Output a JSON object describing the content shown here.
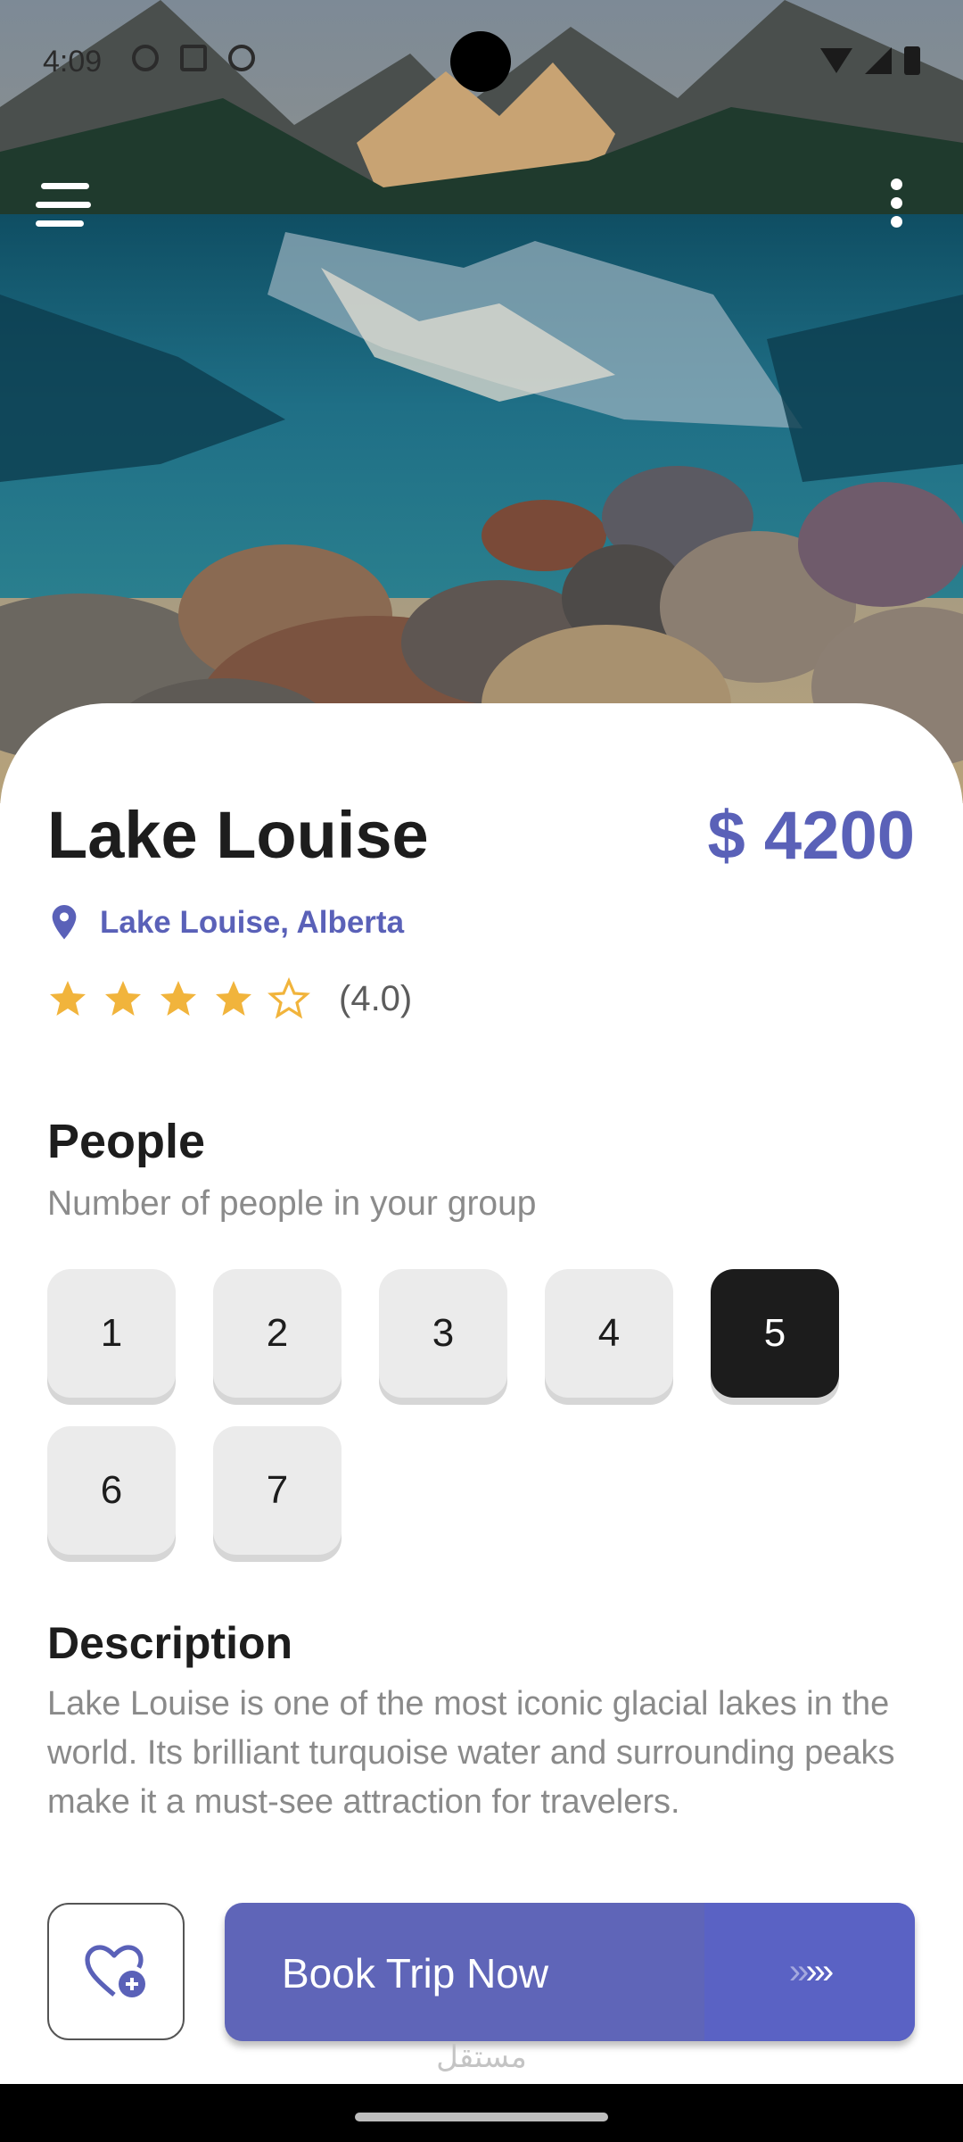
{
  "status_bar": {
    "time": "4:09"
  },
  "destination": {
    "name": "Lake Louise",
    "price": "$ 4200",
    "location": "Lake Louise, Alberta",
    "rating_value": 4.0,
    "rating_text": "(4.0)"
  },
  "people": {
    "heading": "People",
    "subtitle": "Number of people in your group",
    "options": [
      "1",
      "2",
      "3",
      "4",
      "5",
      "6",
      "7"
    ],
    "selected": "5"
  },
  "description": {
    "heading": "Description",
    "text": "Lake Louise is one of the most iconic glacial lakes in the world. Its brilliant turquoise water and surrounding peaks make it a must-see attraction for travelers."
  },
  "actions": {
    "book_label": "Book Trip Now",
    "book_arrows": ">>>>"
  },
  "watermark": "مستقل",
  "colors": {
    "accent": "#5a61b8",
    "star": "#f1b43c",
    "selected_bg": "#1c1c1c",
    "chip_bg": "#ebebeb"
  },
  "icons": [
    "menu-icon",
    "more-vertical-icon",
    "location-pin-icon",
    "star-icon",
    "heart-plus-icon",
    "arrow-right-icon"
  ]
}
